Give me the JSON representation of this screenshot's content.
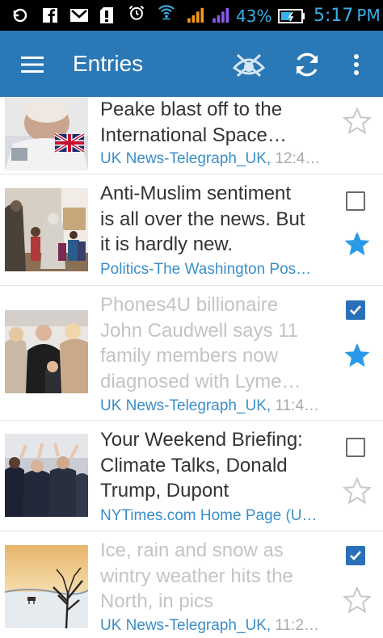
{
  "status_bar": {
    "battery_percent": "43%",
    "time": "5:17",
    "ampm": "PM"
  },
  "app_bar": {
    "title": "Entries",
    "icons": [
      "menu-icon",
      "mark-all-read-icon",
      "refresh-icon",
      "overflow-menu-icon"
    ]
  },
  "entries": [
    {
      "title_lines": [
        "Peake blast off to the",
        "International Space…"
      ],
      "source": "UK News-Telegraph_UK,",
      "time": " 12:4…",
      "read": false,
      "checked": null,
      "starred": false
    },
    {
      "title_lines": [
        "Anti-Muslim sentiment",
        "is all over the news. But",
        "it is hardly new."
      ],
      "source": "Politics-The Washington Pos…",
      "time": "",
      "read": false,
      "checked": false,
      "starred": true
    },
    {
      "title_lines": [
        "Phones4U billionaire",
        "John Caudwell says 11",
        "family members now",
        "diagnosed with Lyme…"
      ],
      "source": "UK News-Telegraph_UK,",
      "time": " 11:4…",
      "read": true,
      "checked": true,
      "starred": true
    },
    {
      "title_lines": [
        "Your Weekend Briefing:",
        "Climate Talks, Donald",
        "Trump, Dupont"
      ],
      "source": "NYTimes.com Home Page (U…",
      "time": "",
      "read": false,
      "checked": false,
      "starred": false
    },
    {
      "title_lines": [
        "Ice, rain and snow as",
        "wintry weather hits the",
        "North, in pics"
      ],
      "source": "UK News-Telegraph_UK,",
      "time": " 11:2…",
      "read": true,
      "checked": true,
      "starred": false
    }
  ],
  "colors": {
    "app_bar": "#2a78b5",
    "source_link": "#3a8ec8",
    "star_filled": "#2a9ae8",
    "checkbox_checked": "#2a70b8"
  }
}
